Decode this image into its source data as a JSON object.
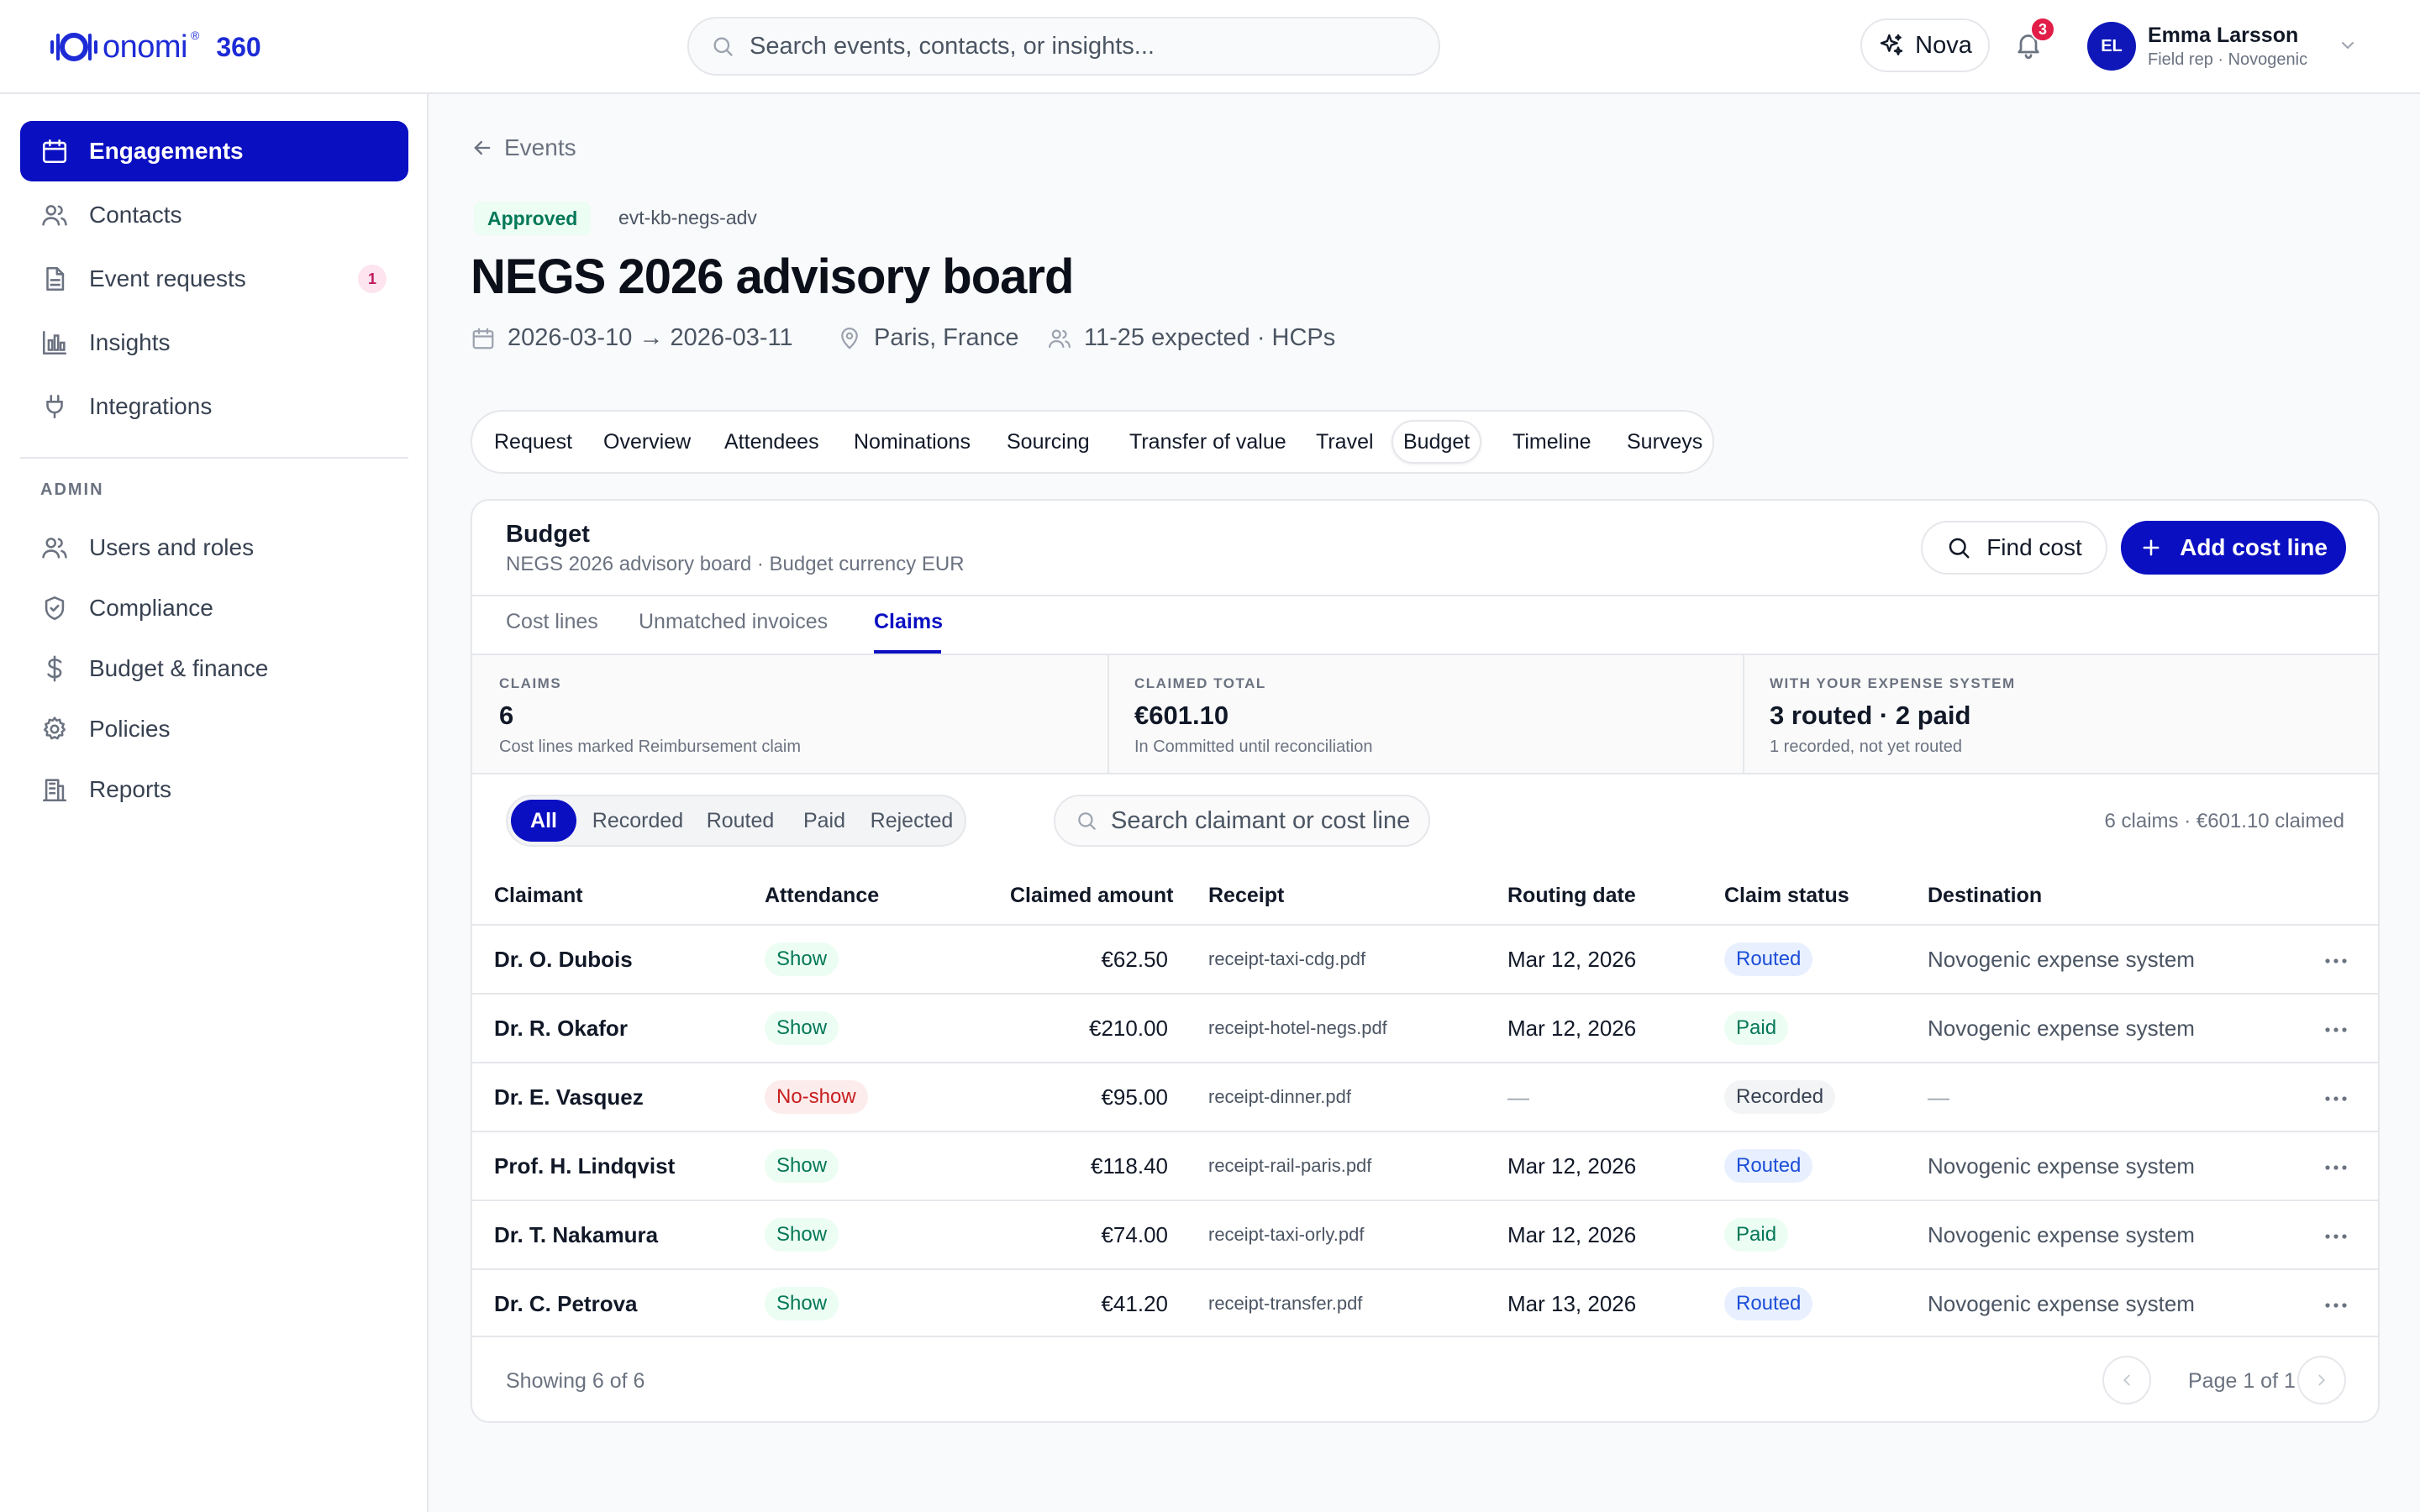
{
  "brand": {
    "name": "onomi",
    "trademark": "®",
    "version": "360",
    "color": "#1d2bd6"
  },
  "search": {
    "placeholder": "Search events, contacts, or insights..."
  },
  "assistant": {
    "label": "Nova"
  },
  "notifications": {
    "count": "3"
  },
  "user": {
    "initials": "EL",
    "name": "Emma Larsson",
    "role": "Field rep · Novogenic"
  },
  "sidebar": {
    "items": [
      {
        "label": "Engagements",
        "icon": "calendar-icon",
        "active": true
      },
      {
        "label": "Contacts",
        "icon": "users-icon"
      },
      {
        "label": "Event requests",
        "icon": "document-icon",
        "count": "1"
      },
      {
        "label": "Insights",
        "icon": "bar-chart-icon"
      },
      {
        "label": "Integrations",
        "icon": "plug-icon"
      }
    ],
    "admin_heading": "ADMIN",
    "admin_items": [
      {
        "label": "Users and roles",
        "icon": "users-icon"
      },
      {
        "label": "Compliance",
        "icon": "shield-icon"
      },
      {
        "label": "Budget & finance",
        "icon": "dollar-icon"
      },
      {
        "label": "Policies",
        "icon": "gear-icon"
      },
      {
        "label": "Reports",
        "icon": "building-icon"
      }
    ]
  },
  "event": {
    "back_label": "Events",
    "status": "Approved",
    "id": "evt-kb-negs-adv",
    "title": "NEGS 2026 advisory board",
    "dates": "2026-03-10 → 2026-03-11",
    "location": "Paris, France",
    "attendance": "11-25 expected · HCPs"
  },
  "tabs": [
    "Request",
    "Overview",
    "Attendees",
    "Nominations",
    "Sourcing",
    "Transfer of value",
    "Travel",
    "Budget",
    "Timeline",
    "Surveys"
  ],
  "active_tab": "Budget",
  "budget": {
    "title": "Budget",
    "subtitle": "NEGS 2026 advisory board · Budget currency EUR",
    "find_label": "Find cost",
    "add_label": "Add cost line",
    "subtabs": [
      "Cost lines",
      "Unmatched invoices",
      "Claims"
    ],
    "active_subtab": "Claims",
    "stats": [
      {
        "label": "CLAIMS",
        "value": "6",
        "note": "Cost lines marked Reimbursement claim"
      },
      {
        "label": "CLAIMED TOTAL",
        "value": "€601.10",
        "note": "In Committed until reconciliation"
      },
      {
        "label": "WITH YOUR EXPENSE SYSTEM",
        "value": "3 routed · 2 paid",
        "note": "1 recorded, not yet routed"
      }
    ],
    "filters": [
      "All",
      "Recorded",
      "Routed",
      "Paid",
      "Rejected"
    ],
    "active_filter": "All",
    "claim_search_placeholder": "Search claimant or cost line",
    "summary": "6 claims · €601.10 claimed",
    "columns": [
      "Claimant",
      "Attendance",
      "Claimed amount",
      "Receipt",
      "Routing date",
      "Claim status",
      "Destination"
    ],
    "rows": [
      {
        "claimant": "Dr. O. Dubois",
        "attendance": "Show",
        "amount": "€62.50",
        "receipt": "receipt-taxi-cdg.pdf",
        "date": "Mar 12, 2026",
        "status": "Routed",
        "destination": "Novogenic expense system"
      },
      {
        "claimant": "Dr. R. Okafor",
        "attendance": "Show",
        "amount": "€210.00",
        "receipt": "receipt-hotel-negs.pdf",
        "date": "Mar 12, 2026",
        "status": "Paid",
        "destination": "Novogenic expense system"
      },
      {
        "claimant": "Dr. E. Vasquez",
        "attendance": "No-show",
        "amount": "€95.00",
        "receipt": "receipt-dinner.pdf",
        "date": "—",
        "status": "Recorded",
        "destination": "—"
      },
      {
        "claimant": "Prof. H. Lindqvist",
        "attendance": "Show",
        "amount": "€118.40",
        "receipt": "receipt-rail-paris.pdf",
        "date": "Mar 12, 2026",
        "status": "Routed",
        "destination": "Novogenic expense system"
      },
      {
        "claimant": "Dr. T. Nakamura",
        "attendance": "Show",
        "amount": "€74.00",
        "receipt": "receipt-taxi-orly.pdf",
        "date": "Mar 12, 2026",
        "status": "Paid",
        "destination": "Novogenic expense system"
      },
      {
        "claimant": "Dr. C. Petrova",
        "attendance": "Show",
        "amount": "€41.20",
        "receipt": "receipt-transfer.pdf",
        "date": "Mar 13, 2026",
        "status": "Routed",
        "destination": "Novogenic expense system"
      }
    ],
    "showing": "Showing 6 of 6",
    "page_label": "Page 1 of 1"
  },
  "colors": {
    "accent": "#0b0fc2",
    "success": "#047857",
    "danger": "#c81e1e",
    "info": "#1d4ed8"
  }
}
